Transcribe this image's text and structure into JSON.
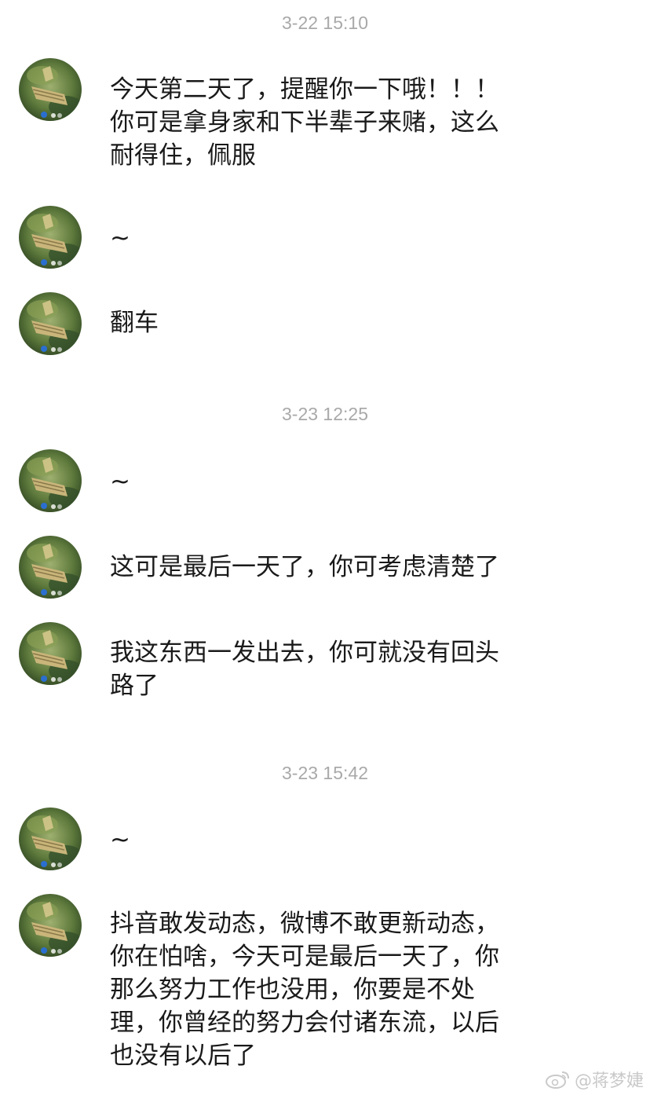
{
  "timestamps": [
    "3-22 15:10",
    "3-23 12:25",
    "3-23 15:42"
  ],
  "messages": [
    {
      "text": "今天第二天了，提醒你一下哦！！！\n你可是拿身家和下半辈子来赌，这么\n耐得住，佩服"
    },
    {
      "text": "~"
    },
    {
      "text": "翻车"
    },
    {
      "text": "~"
    },
    {
      "text": "这可是最后一天了，你可考虑清楚了"
    },
    {
      "text": "我这东西一发出去，你可就没有回头\n路了"
    },
    {
      "text": "~"
    },
    {
      "text": "抖音敢发动态，微博不敢更新动态，\n你在怕啥，今天可是最后一天了，你\n那么努力工作也没用，你要是不处\n理，你曾经的努力会付诸东流，以后\n也没有以后了"
    }
  ],
  "watermark": {
    "text": "@蒋梦婕",
    "icon": "weibo-icon"
  },
  "colors": {
    "timestamp": "#a9a9a9",
    "text": "#1a1a1a",
    "background": "#ffffff"
  }
}
